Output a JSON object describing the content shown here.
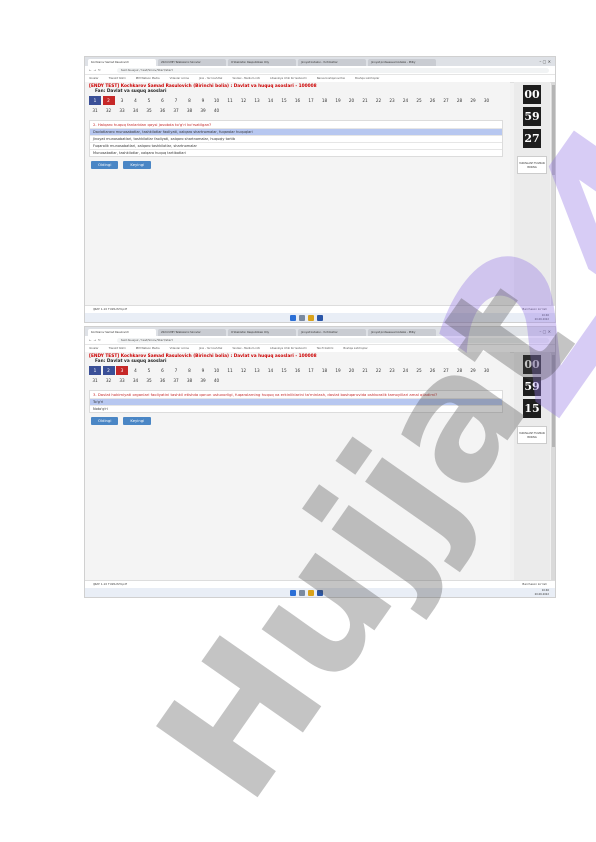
{
  "browser": {
    "tabs": [
      "Kochkarov Samad Rasulovich",
      "2024 UMH Talabalarni Sinovlar",
      "O'zbekiston Respublikasi Oliy",
      "Jinoyat kodeksi - Yurtdoshlar",
      "Jinoyat protsessual kodeksi - Milliy"
    ],
    "url": "test.tsuejuz / test/Sinov/Start/start",
    "bookmarks": [
      "Ilovalar",
      "Translit tizimi",
      "IBM Watson Media",
      "Videolar online",
      "Jinsi - Yer kosh-Tez",
      "Yandex - Medium.info",
      "Litsenziya Ichki Ko'rsatuvchi",
      "Nexus boshqaruvchisi",
      "Tex-Ti bistimi",
      "Boshqa xatchoplar"
    ]
  },
  "exam": {
    "title": "[ENDY TEST]    Kochkarov Samad Rasulovich (Birinchi bolia) : Davlat va huquq asoslari - 100008",
    "subject": "Fan:  Davlat va suquq asoslari",
    "numbers": [
      "1",
      "2",
      "3",
      "4",
      "5",
      "6",
      "7",
      "8",
      "9",
      "10",
      "11",
      "12",
      "13",
      "14",
      "15",
      "16",
      "17",
      "18",
      "19",
      "20",
      "21",
      "22",
      "23",
      "24",
      "25",
      "26",
      "27",
      "28",
      "29",
      "30",
      "31",
      "32",
      "33",
      "34",
      "35",
      "36",
      "37",
      "38",
      "39",
      "40"
    ],
    "btn_prev": "Oldingi",
    "btn_next": "Keyingi",
    "yakun": "YAKUNLASH TUGMASI BOSING",
    "downloads_file": "IJRAT 1-10 TUZILISHI.pdf",
    "downloads_show": "Barchasini ko'rish",
    "clock_time": "10:46",
    "clock_date": "20.06.2022"
  },
  "shots": [
    {
      "question": "2.  Halqaro huquq fanlaridan qaysi javobda to'g'ri ko'rsatilgan?",
      "options": [
        "Davlatlararo munosabatlar, tashkilotlar faoliyati, xalqaro shartnomalar, fuqarolar huquqlari",
        "Jinoyat munosabatlari, tashkilotlar faoliyati, xalqaro shartnomalar, huquqiy tartib",
        "Fuqarolik munosabatlari, xalqaro tashkilotlar, shartnomalar",
        "Munosabatlar, tashkilotlar, xalqaro huquq tartibotlari"
      ],
      "timer": [
        "00",
        "59",
        "27"
      ]
    },
    {
      "question": "3.  Davlat hokimiyati organlari faoliyatini tashkil etishda qonun ustuvorligi, fuqarolarning huquq va erkinliklarini ta'minlash, davlat boshqaruvida oshkoralik tamoyillari amal qiladimi?",
      "options": [
        "To'g'ri",
        "Noto'g'ri"
      ],
      "timer": [
        "00",
        "59",
        "15"
      ]
    }
  ],
  "watermark": {
    "number": "24",
    "brand": "Hujjat"
  }
}
